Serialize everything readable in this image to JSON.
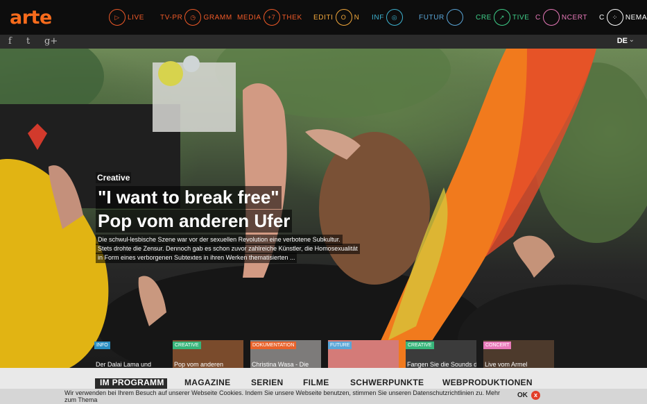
{
  "brand": {
    "logo": "arte",
    "accent": "#f76b1c"
  },
  "nav": {
    "items": [
      {
        "pre": "",
        "circle": "▷",
        "post": "LIVE",
        "color": "#f05a28",
        "icon": "play-icon"
      },
      {
        "pre": "TV-PR",
        "circle": "◷",
        "post": "GRAMM",
        "color": "#f05a28",
        "icon": "clock-icon"
      },
      {
        "pre": "MEDIA",
        "circle": "+7",
        "post": "THEK",
        "color": "#f05a28",
        "icon": "plus7-icon"
      },
      {
        "pre": "EDITI",
        "circle": "O",
        "post": "N",
        "color": "#f3a83b",
        "icon": "circle-icon"
      },
      {
        "pre": "INF",
        "circle": "◎",
        "post": "",
        "color": "#3eb3d1",
        "icon": "target-icon"
      },
      {
        "pre": "FUTUR",
        "circle": "",
        "post": "",
        "color": "#5aa6d8",
        "icon": "circle-icon"
      },
      {
        "pre": "CRE",
        "circle": "↗",
        "post": "TIVE",
        "color": "#3fd08a",
        "icon": "arrow-icon"
      },
      {
        "pre": "C",
        "circle": "",
        "post": "NCERT",
        "color": "#e879b9",
        "icon": "circle-icon"
      },
      {
        "pre": "C",
        "circle": "⁘",
        "post": "NEMA",
        "color": "#ffffff",
        "icon": "dots-icon"
      }
    ]
  },
  "social": {
    "facebook": "f",
    "twitter": "t",
    "googleplus": "g+",
    "language": "DE"
  },
  "hero": {
    "category": "Creative",
    "title_line1": "\"I want to break free\"",
    "title_line2": "Pop vom anderen Ufer",
    "desc_line1": "Die schwul-lesbische Szene war vor der sexuellen Revolution eine verbotene Subkultur.",
    "desc_line2": "Stets drohte die Zensur. Dennoch gab es schon zuvor zahlreiche Künstler, die Homosexualität",
    "desc_line3": "in Form eines verborgenen Subtextes in ihren Werken thematisierten ..."
  },
  "cards": [
    {
      "tag": "INFO",
      "tag_color": "#2a8ec2",
      "title": "Der Dalai Lama und",
      "bg": "#2a2a2a"
    },
    {
      "tag": "CREATIVE",
      "tag_color": "#37b57a",
      "title": "Pop vom anderen",
      "bg": "#7a4b2c"
    },
    {
      "tag": "DOKUMENTATION",
      "tag_color": "#e8632b",
      "title": "Christina Wasa - Die",
      "bg": "#7d7b7a"
    },
    {
      "tag": "FUTURE",
      "tag_color": "#5aa6d8",
      "title": "",
      "bg": "#d47b78"
    },
    {
      "tag": "CREATIVE",
      "tag_color": "#37b57a",
      "title": "Fangen Sie die Sounds des Alltags",
      "bg": "#3b3b3b"
    },
    {
      "tag": "CONCERT",
      "tag_color": "#e879b9",
      "title": "Live vom Armel",
      "bg": "#4d3a2c"
    }
  ],
  "bottomnav": [
    "IM PROGRAMM",
    "MAGAZINE",
    "SERIEN",
    "FILME",
    "SCHWERPUNKTE",
    "WEBPRODUKTIONEN"
  ],
  "cookie": {
    "text": "Wir verwenden bei Ihrem Besuch auf unserer Webseite Cookies. Indem Sie unsere Webseite benutzen, stimmen Sie unseren Datenschutzrichtlinien zu. Mehr zum Thema",
    "ok": "OK",
    "close": "x"
  }
}
